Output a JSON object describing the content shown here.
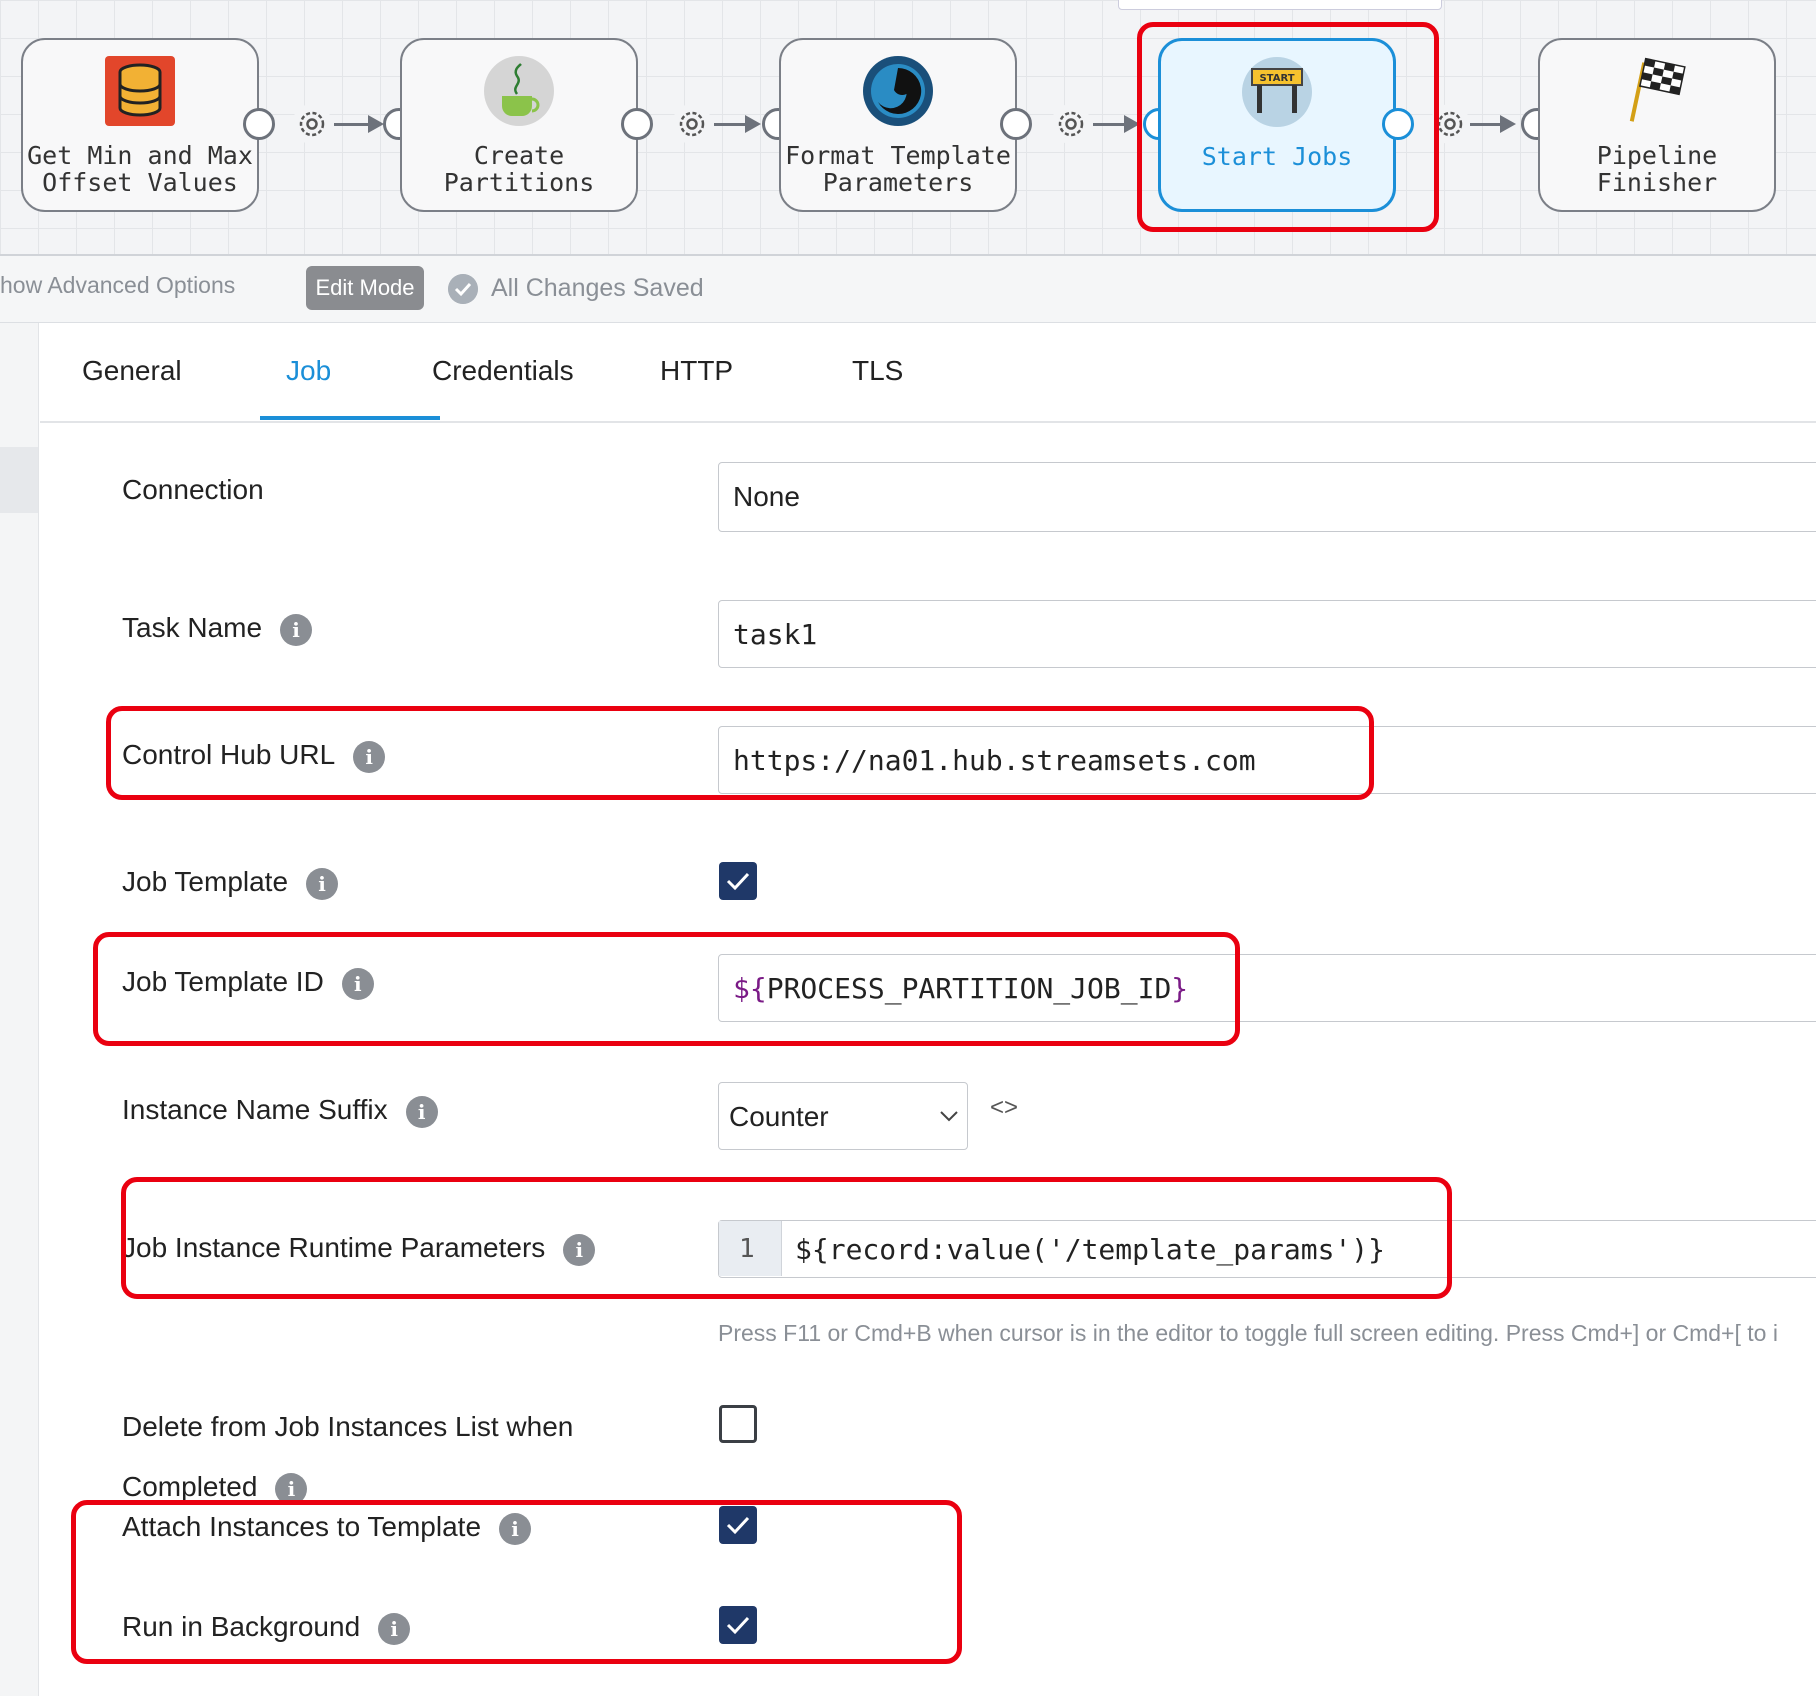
{
  "pipeline": {
    "stages": [
      {
        "label": "Get Min and Max\nOffset Values",
        "icon": "database-icon"
      },
      {
        "label": "Create\nPartitions",
        "icon": "jython-cup-icon"
      },
      {
        "label": "Format Template\nParameters",
        "icon": "groovy-swirl-icon"
      },
      {
        "label": "Start Jobs",
        "icon": "start-sign-icon",
        "selected": true
      },
      {
        "label": "Pipeline\nFinisher",
        "icon": "checkered-flag-icon"
      }
    ]
  },
  "toolbar": {
    "advanced_options": "how Advanced Options",
    "edit_mode": "Edit Mode",
    "saved_status": "All Changes Saved"
  },
  "tabs": [
    "General",
    "Job",
    "Credentials",
    "HTTP",
    "TLS"
  ],
  "active_tab": "Job",
  "form": {
    "connection": {
      "label": "Connection",
      "value": "None"
    },
    "task_name": {
      "label": "Task Name",
      "value": "task1"
    },
    "control_hub_url": {
      "label": "Control Hub URL",
      "value": "https://na01.hub.streamsets.com"
    },
    "job_template": {
      "label": "Job Template",
      "checked": true
    },
    "job_template_id": {
      "label": "Job Template ID",
      "value_prefix": "${",
      "value_name": "PROCESS_PARTITION_JOB_ID",
      "value_suffix": "}"
    },
    "instance_name_suffix": {
      "label": "Instance Name Suffix",
      "value": "Counter",
      "toggle_glyph": "<>"
    },
    "runtime_params": {
      "label": "Job Instance Runtime Parameters",
      "line_number": "1",
      "value": "${record:value('/template_params')}"
    },
    "editor_help": "Press F11 or Cmd+B when cursor is in the editor to toggle full screen editing. Press Cmd+] or Cmd+[ to i",
    "delete_from_list": {
      "label_line1": "Delete from Job Instances List when",
      "label_line2": "Completed",
      "checked": false
    },
    "attach_instances": {
      "label": "Attach Instances to Template",
      "checked": true
    },
    "run_in_background": {
      "label": "Run in Background",
      "checked": true
    },
    "info_glyph": "i"
  },
  "colors": {
    "accent": "#1b8fd8",
    "checkbox": "#1f3868",
    "highlight": "#ea0010",
    "template_var": "#7a1a86"
  }
}
